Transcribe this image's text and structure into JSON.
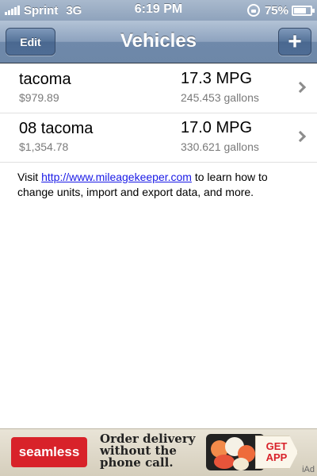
{
  "status_bar": {
    "carrier": "Sprint",
    "network": "3G",
    "time": "6:19 PM",
    "battery": "75%",
    "icons": [
      "signal-bars-icon",
      "rotation-lock-icon",
      "battery-icon"
    ]
  },
  "nav": {
    "title": "Vehicles",
    "edit_label": "Edit",
    "add_label": "+"
  },
  "vehicles": [
    {
      "name": "tacoma",
      "cost": "$979.89",
      "mpg": "17.3 MPG",
      "gallons": "245.453 gallons"
    },
    {
      "name": "08 tacoma",
      "cost": "$1,354.78",
      "mpg": "17.0 MPG",
      "gallons": "330.621 gallons"
    }
  ],
  "info": {
    "prefix": "Visit ",
    "link_text": "http://www.mileagekeeper.com",
    "suffix": " to learn how to change units, import and export data, and more."
  },
  "ad": {
    "brand": "seamless",
    "line1": "Order delivery",
    "line2": "without the",
    "line3": "phone call.",
    "cta_line1": "GET",
    "cta_line2": "APP",
    "iad_label": "iAd"
  },
  "colors": {
    "nav_bar": "#7890af",
    "link": "#1a1ae6",
    "ad_brand": "#d8222a"
  }
}
